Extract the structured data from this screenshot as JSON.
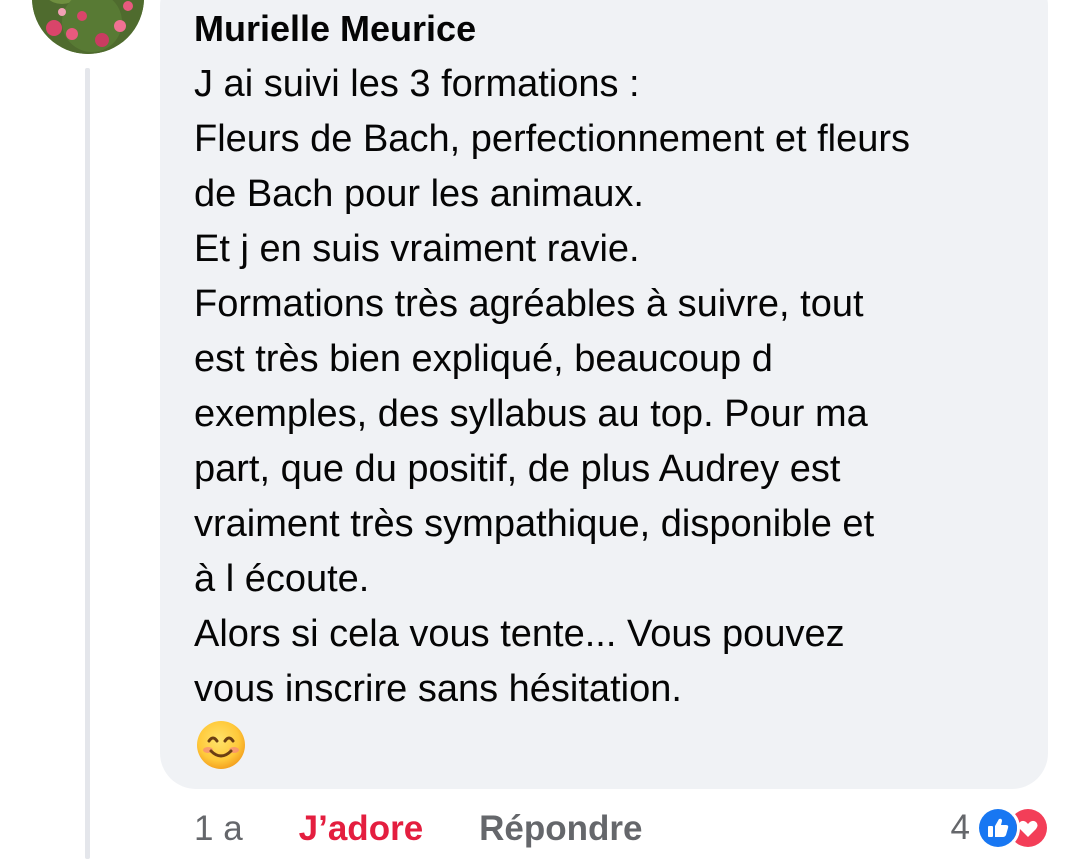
{
  "comment": {
    "author": "Murielle Meurice",
    "lines": [
      "J ai suivi les 3 formations :",
      "Fleurs de Bach, perfectionnement et fleurs",
      "de Bach pour les animaux.",
      "Et j en suis vraiment ravie.",
      "Formations très agréables à suivre, tout",
      "est très bien expliqué, beaucoup d",
      "exemples, des syllabus au top. Pour ma",
      "part, que du positif, de plus Audrey est",
      "vraiment très sympathique, disponible et",
      "à l écoute.",
      "Alors si cela vous tente... Vous pouvez",
      "vous inscrire sans hésitation."
    ],
    "emoji": "smiling-face-with-smiling-eyes"
  },
  "actions": {
    "time": "1 a",
    "reaction_label": "J’adore",
    "reply_label": "Répondre",
    "reaction_count": "4",
    "reaction_icons": [
      "like-icon",
      "love-icon"
    ]
  },
  "colors": {
    "bubble": "#f0f2f5",
    "love": "#e41e3f",
    "like": "#1877f2",
    "meta": "#65676b",
    "text": "#050505"
  }
}
